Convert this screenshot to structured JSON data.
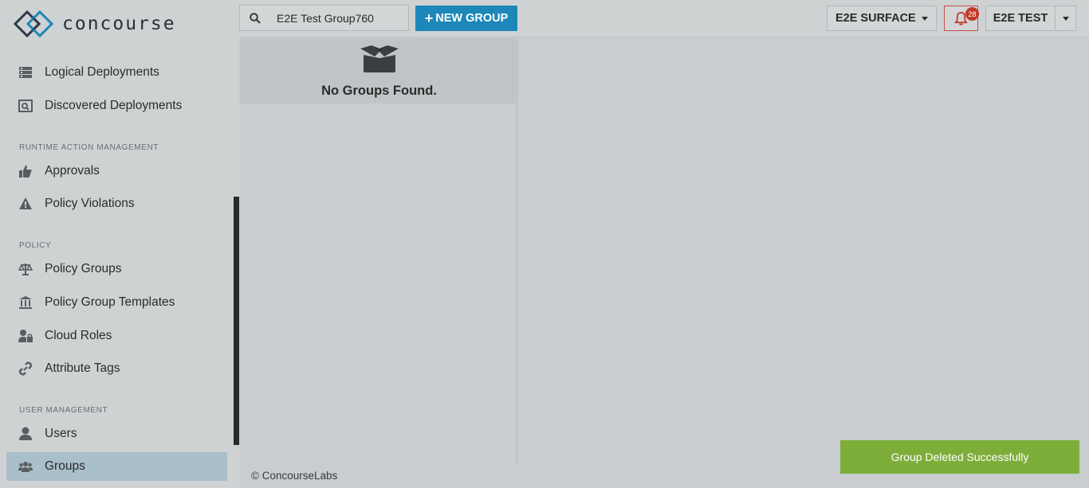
{
  "app": {
    "logo_text": "concourse"
  },
  "sidebar": {
    "items_top": [
      {
        "label": "Logical Deployments",
        "icon": "server-icon"
      },
      {
        "label": "Discovered Deployments",
        "icon": "discover-icon"
      }
    ],
    "sections": [
      {
        "title": "RUNTIME ACTION MANAGEMENT",
        "items": [
          {
            "label": "Approvals",
            "icon": "thumbs-up-icon"
          },
          {
            "label": "Policy Violations",
            "icon": "warning-icon"
          }
        ]
      },
      {
        "title": "POLICY",
        "items": [
          {
            "label": "Policy Groups",
            "icon": "balance-scale-icon"
          },
          {
            "label": "Policy Group Templates",
            "icon": "institution-icon"
          },
          {
            "label": "Cloud Roles",
            "icon": "user-lock-icon"
          },
          {
            "label": "Attribute Tags",
            "icon": "link-icon"
          }
        ]
      },
      {
        "title": "USER MANAGEMENT",
        "items": [
          {
            "label": "Users",
            "icon": "user-icon"
          },
          {
            "label": "Groups",
            "icon": "users-icon",
            "active": true
          }
        ]
      }
    ]
  },
  "topbar": {
    "search": {
      "value": "E2E Test Group760",
      "icon": "search-icon"
    },
    "new_group_label": "NEW GROUP",
    "surface_label": "E2E SURFACE",
    "notifications": {
      "count": "28",
      "icon": "bell-icon"
    },
    "user_label": "E2E TEST"
  },
  "list": {
    "empty_text": "No Groups Found.",
    "empty_icon": "open-box-icon"
  },
  "footer": {
    "text": "© ConcourseLabs"
  },
  "toast": {
    "text": "Group Deleted Successfully"
  },
  "colors": {
    "accent": "#1d87b9",
    "active_nav": "#a9bfca",
    "toast": "#7eae3a",
    "notification": "#c0392b"
  }
}
